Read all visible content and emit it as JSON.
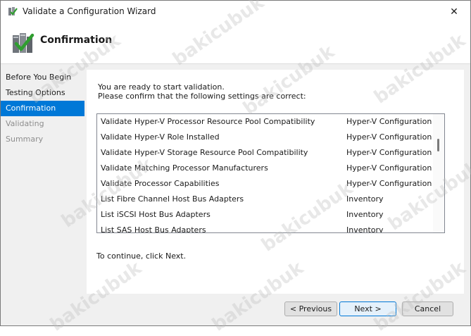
{
  "window": {
    "title": "Validate a Configuration Wizard",
    "close_glyph": "✕"
  },
  "header": {
    "title": "Confirmation"
  },
  "nav": {
    "items": [
      {
        "label": "Before You Begin",
        "state": "normal"
      },
      {
        "label": "Testing Options",
        "state": "normal"
      },
      {
        "label": "Confirmation",
        "state": "active"
      },
      {
        "label": "Validating",
        "state": "disabled"
      },
      {
        "label": "Summary",
        "state": "disabled"
      }
    ]
  },
  "main": {
    "intro_line1": "You are ready to start validation.",
    "intro_line2": "Please confirm that the following settings are correct:",
    "tests": [
      {
        "name": "Validate Hyper-V Processor Resource Pool Compatibility",
        "category": "Hyper-V Configuration"
      },
      {
        "name": "Validate Hyper-V Role Installed",
        "category": "Hyper-V Configuration"
      },
      {
        "name": "Validate Hyper-V Storage Resource Pool Compatibility",
        "category": "Hyper-V Configuration"
      },
      {
        "name": "Validate Matching Processor Manufacturers",
        "category": "Hyper-V Configuration"
      },
      {
        "name": "Validate Processor Capabilities",
        "category": "Hyper-V Configuration"
      },
      {
        "name": "List Fibre Channel Host Bus Adapters",
        "category": "Inventory"
      },
      {
        "name": "List iSCSI Host Bus Adapters",
        "category": "Inventory"
      },
      {
        "name": "List SAS Host Bus Adapters",
        "category": "Inventory"
      }
    ],
    "continue_text": "To continue, click Next."
  },
  "footer": {
    "previous_label": "< Previous",
    "next_label": "Next >",
    "cancel_label": "Cancel"
  },
  "watermark": "bakicubuk",
  "colors": {
    "accent": "#0078d7",
    "content_bg": "#f0f0f0",
    "disabled_text": "#8e8e8e"
  }
}
